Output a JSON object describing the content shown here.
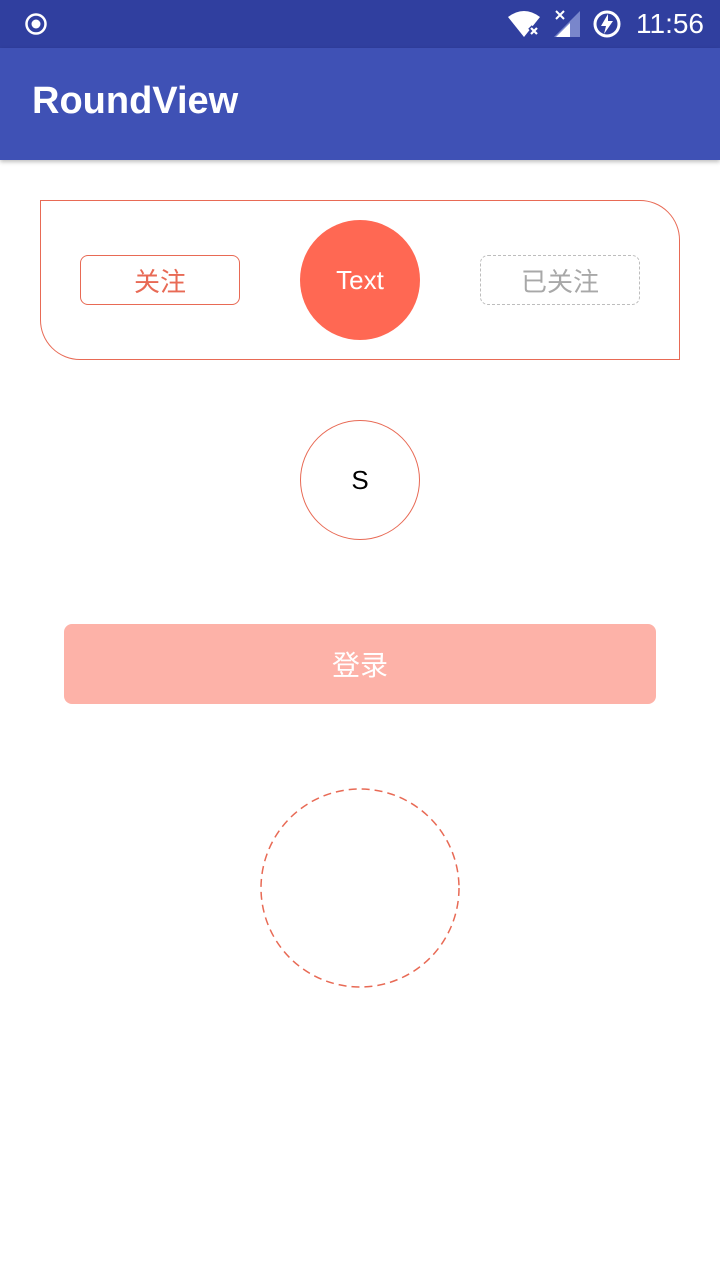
{
  "status_bar": {
    "time": "11:56",
    "icons": [
      "record-icon",
      "wifi-icon",
      "signal-icon",
      "battery-charging-icon"
    ]
  },
  "app_bar": {
    "title": "RoundView"
  },
  "card": {
    "follow_label": "关注",
    "circle_label": "Text",
    "followed_label": "已关注"
  },
  "avatar_circle": {
    "label": "S"
  },
  "login": {
    "label": "登录"
  },
  "colors": {
    "status_bar": "#303f9f",
    "app_bar": "#3f51b5",
    "accent": "#ff6853",
    "accent_border": "#e86a55",
    "login_bg": "#fdb2a8",
    "disabled_border": "#bdbdbd",
    "disabled_text": "#a8a8a8"
  }
}
